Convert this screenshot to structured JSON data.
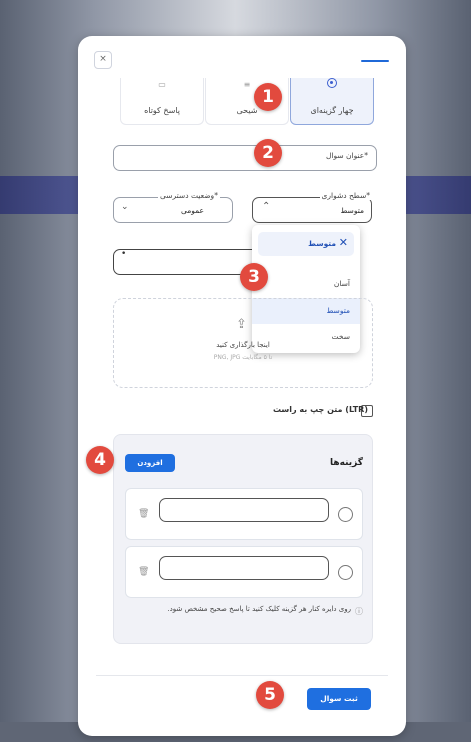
{
  "form": {
    "close_label": "×",
    "types": {
      "short_answer": "پاسخ کوتاه",
      "descriptive": "شیحی",
      "multiple_choice": "چهار گزینه‌ای"
    },
    "title_label": "عنوان سوال*",
    "difficulty_label": "سطح دشواری*",
    "difficulty_value": "متوسط",
    "access_label": "وضعیت دسترسی*",
    "access_value": "عمومی",
    "dropdown": {
      "search_value": "متوسط",
      "options": [
        "آسان",
        "متوسط",
        "سخت"
      ],
      "selected": "متوسط"
    },
    "extra_field_value": "•",
    "upload": {
      "icon": "upload-icon",
      "title": "اینجا بارگذاری کنید",
      "hint": "PNG, JPG تا ۵ مگابایت"
    },
    "rtl_checkbox_label": "متن چپ به راست (LTR)",
    "options_section": {
      "title": "گزینه‌ها",
      "add_label": "افزودن",
      "option_values": [
        "",
        ""
      ],
      "hint": "روی دایره کنار هر گزینه کلیک کنید تا پاسخ صحیح مشخص شود."
    },
    "submit_label": "ثبت سوال"
  },
  "annotations": [
    "1",
    "2",
    "3",
    "4",
    "5"
  ],
  "colors": {
    "accent": "#1f6fe0",
    "badge": "#e24a3e",
    "selected_card_bg": "#eef2fb"
  }
}
